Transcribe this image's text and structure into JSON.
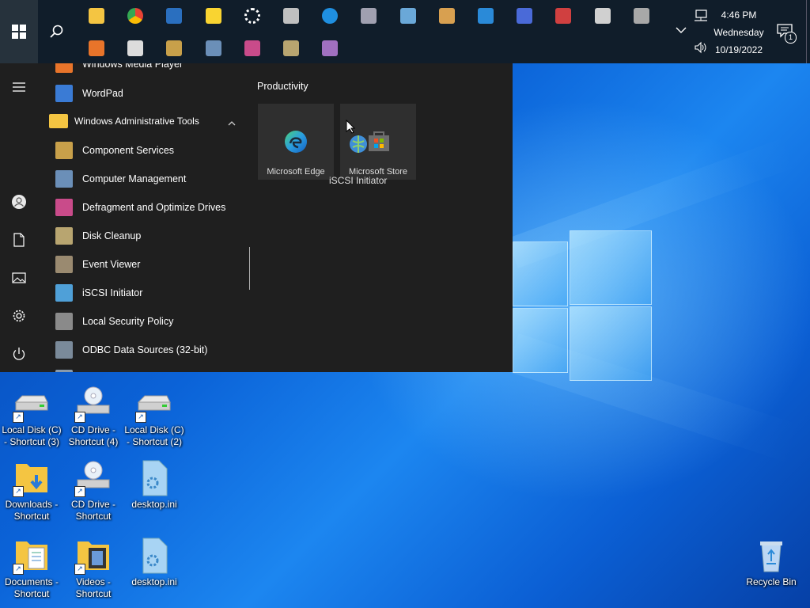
{
  "taskbar": {
    "pinned_row1": [
      "file-explorer-icon",
      "chrome-icon",
      "media-icon",
      "sticky-notes-icon",
      "settings-gear-icon",
      "character-map-icon",
      "internet-explorer-icon",
      "tablet-input-icon",
      "generic-app-icon",
      "paint-icon",
      "remote-desktop-icon",
      "system-config-icon",
      "connect-icon",
      "registry-icon",
      "printer-icon"
    ],
    "pinned_row2": [
      "media-player-icon",
      "notepad-icon",
      "component-services-icon",
      "computer-management-icon",
      "defragment-icon",
      "disk-cleanup-icon",
      "iexpress-icon"
    ],
    "clock": {
      "time": "4:46 PM",
      "day": "Wednesday",
      "date": "10/19/2022"
    },
    "notification_count": "1"
  },
  "start_menu": {
    "partial_top_item": "Windows Media Player",
    "items": [
      {
        "label": "WordPad",
        "color": "#3a7bd5"
      },
      {
        "label": "Windows Administrative Tools",
        "color": "#f4c542"
      },
      {
        "label": "Component Services",
        "color": "#c8a04a"
      },
      {
        "label": "Computer Management",
        "color": "#6b8fb8"
      },
      {
        "label": "Defragment and Optimize Drives",
        "color": "#c94b8a"
      },
      {
        "label": "Disk Cleanup",
        "color": "#b8a570"
      },
      {
        "label": "Event Viewer",
        "color": "#9a8a70"
      },
      {
        "label": "iSCSI Initiator",
        "color": "#4fa0d8"
      },
      {
        "label": "Local Security Policy",
        "color": "#8a8a8a"
      },
      {
        "label": "ODBC Data Sources (32-bit)",
        "color": "#7a8a9a"
      }
    ],
    "tiles_group_title": "Productivity",
    "tiles": [
      {
        "label": "Microsoft Edge"
      },
      {
        "label": "Microsoft Store"
      }
    ],
    "drag_label": "iSCSI Initiator"
  },
  "desktop": {
    "icons": [
      {
        "label": "Local Disk (C) - Shortcut (3)",
        "kind": "disk"
      },
      {
        "label": "CD Drive - Shortcut (4)",
        "kind": "cd"
      },
      {
        "label": "Local Disk (C) - Shortcut (2)",
        "kind": "disk"
      },
      {
        "label": "Downloads - Shortcut",
        "kind": "folder-down"
      },
      {
        "label": "CD Drive - Shortcut",
        "kind": "cd"
      },
      {
        "label": "desktop.ini",
        "kind": "ini"
      },
      {
        "label": "Documents - Shortcut",
        "kind": "folder-doc"
      },
      {
        "label": "Videos - Shortcut",
        "kind": "folder-video"
      },
      {
        "label": "desktop.ini",
        "kind": "ini"
      }
    ],
    "recycle_bin": "Recycle Bin"
  }
}
